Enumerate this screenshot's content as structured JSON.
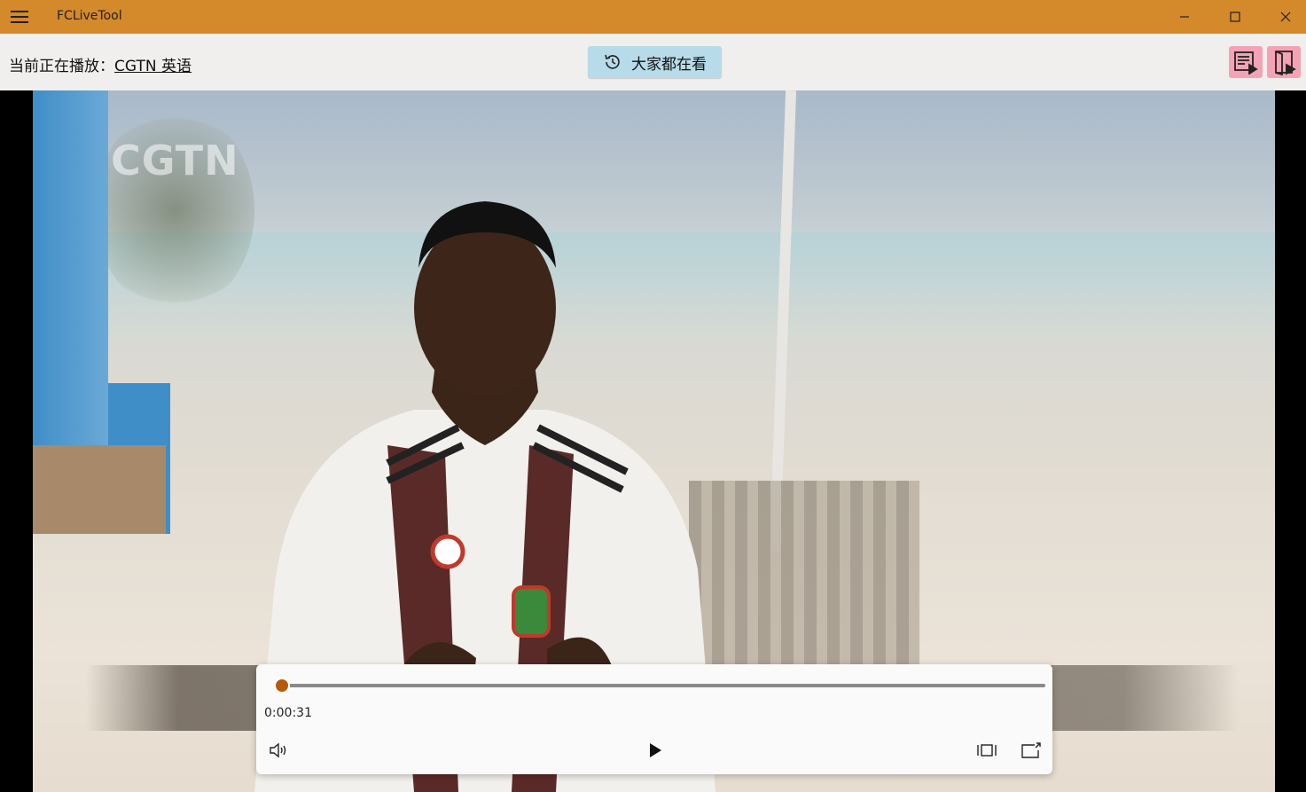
{
  "titlebar": {
    "app_title": "FCLiveTool",
    "menu_icon": "hamburger-menu-icon",
    "minimize_icon": "minimize-icon",
    "maximize_icon": "maximize-icon",
    "close_icon": "close-icon",
    "color": "#d4892b"
  },
  "header": {
    "now_playing_label": "当前正在播放：",
    "channel_name": "CGTN 英语",
    "popular_button_label": "大家都在看",
    "popular_button_icon": "history-icon",
    "playlist_button_icon": "playlist-play-icon",
    "open_button_icon": "open-player-icon",
    "popular_button_color": "#b7dbe8",
    "action_button_color": "#f4a3b4"
  },
  "video": {
    "watermark": "CGTN"
  },
  "player": {
    "elapsed_time": "0:00:31",
    "progress_fraction": 0.01,
    "accent_color": "#b55a08",
    "volume_icon": "volume-icon",
    "play_icon": "play-icon",
    "aspect_ratio_icon": "aspect-ratio-icon",
    "compact_overlay_icon": "compact-overlay-icon"
  }
}
